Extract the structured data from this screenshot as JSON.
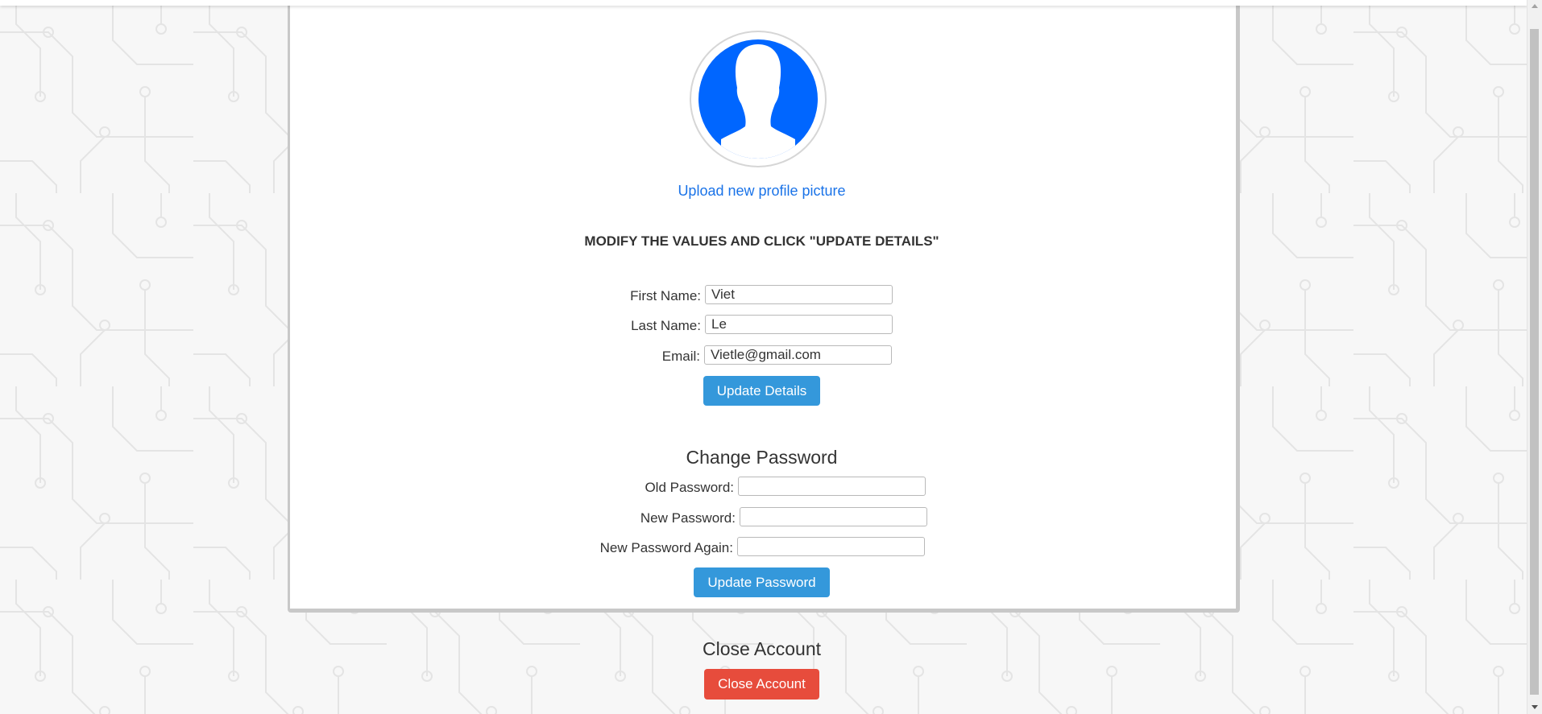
{
  "profile": {
    "upload_link": "Upload new profile picture",
    "instructions": "MODIFY THE VALUES AND CLICK \"UPDATE DETAILS\""
  },
  "details": {
    "first_name_label": "First Name:",
    "first_name_value": "Viet",
    "last_name_label": "Last Name:",
    "last_name_value": "Le",
    "email_label": "Email:",
    "email_value": "Vietle@gmail.com",
    "update_button": "Update Details"
  },
  "password": {
    "title": "Change Password",
    "old_label": "Old Password:",
    "new_label": "New Password:",
    "again_label": "New Password Again:",
    "update_button": "Update Password"
  },
  "close_account": {
    "title": "Close Account",
    "button": "Close Account"
  },
  "colors": {
    "primary_button": "#3498db",
    "danger_button": "#e74c3c",
    "link": "#1a73e8",
    "avatar": "#0066ff"
  }
}
